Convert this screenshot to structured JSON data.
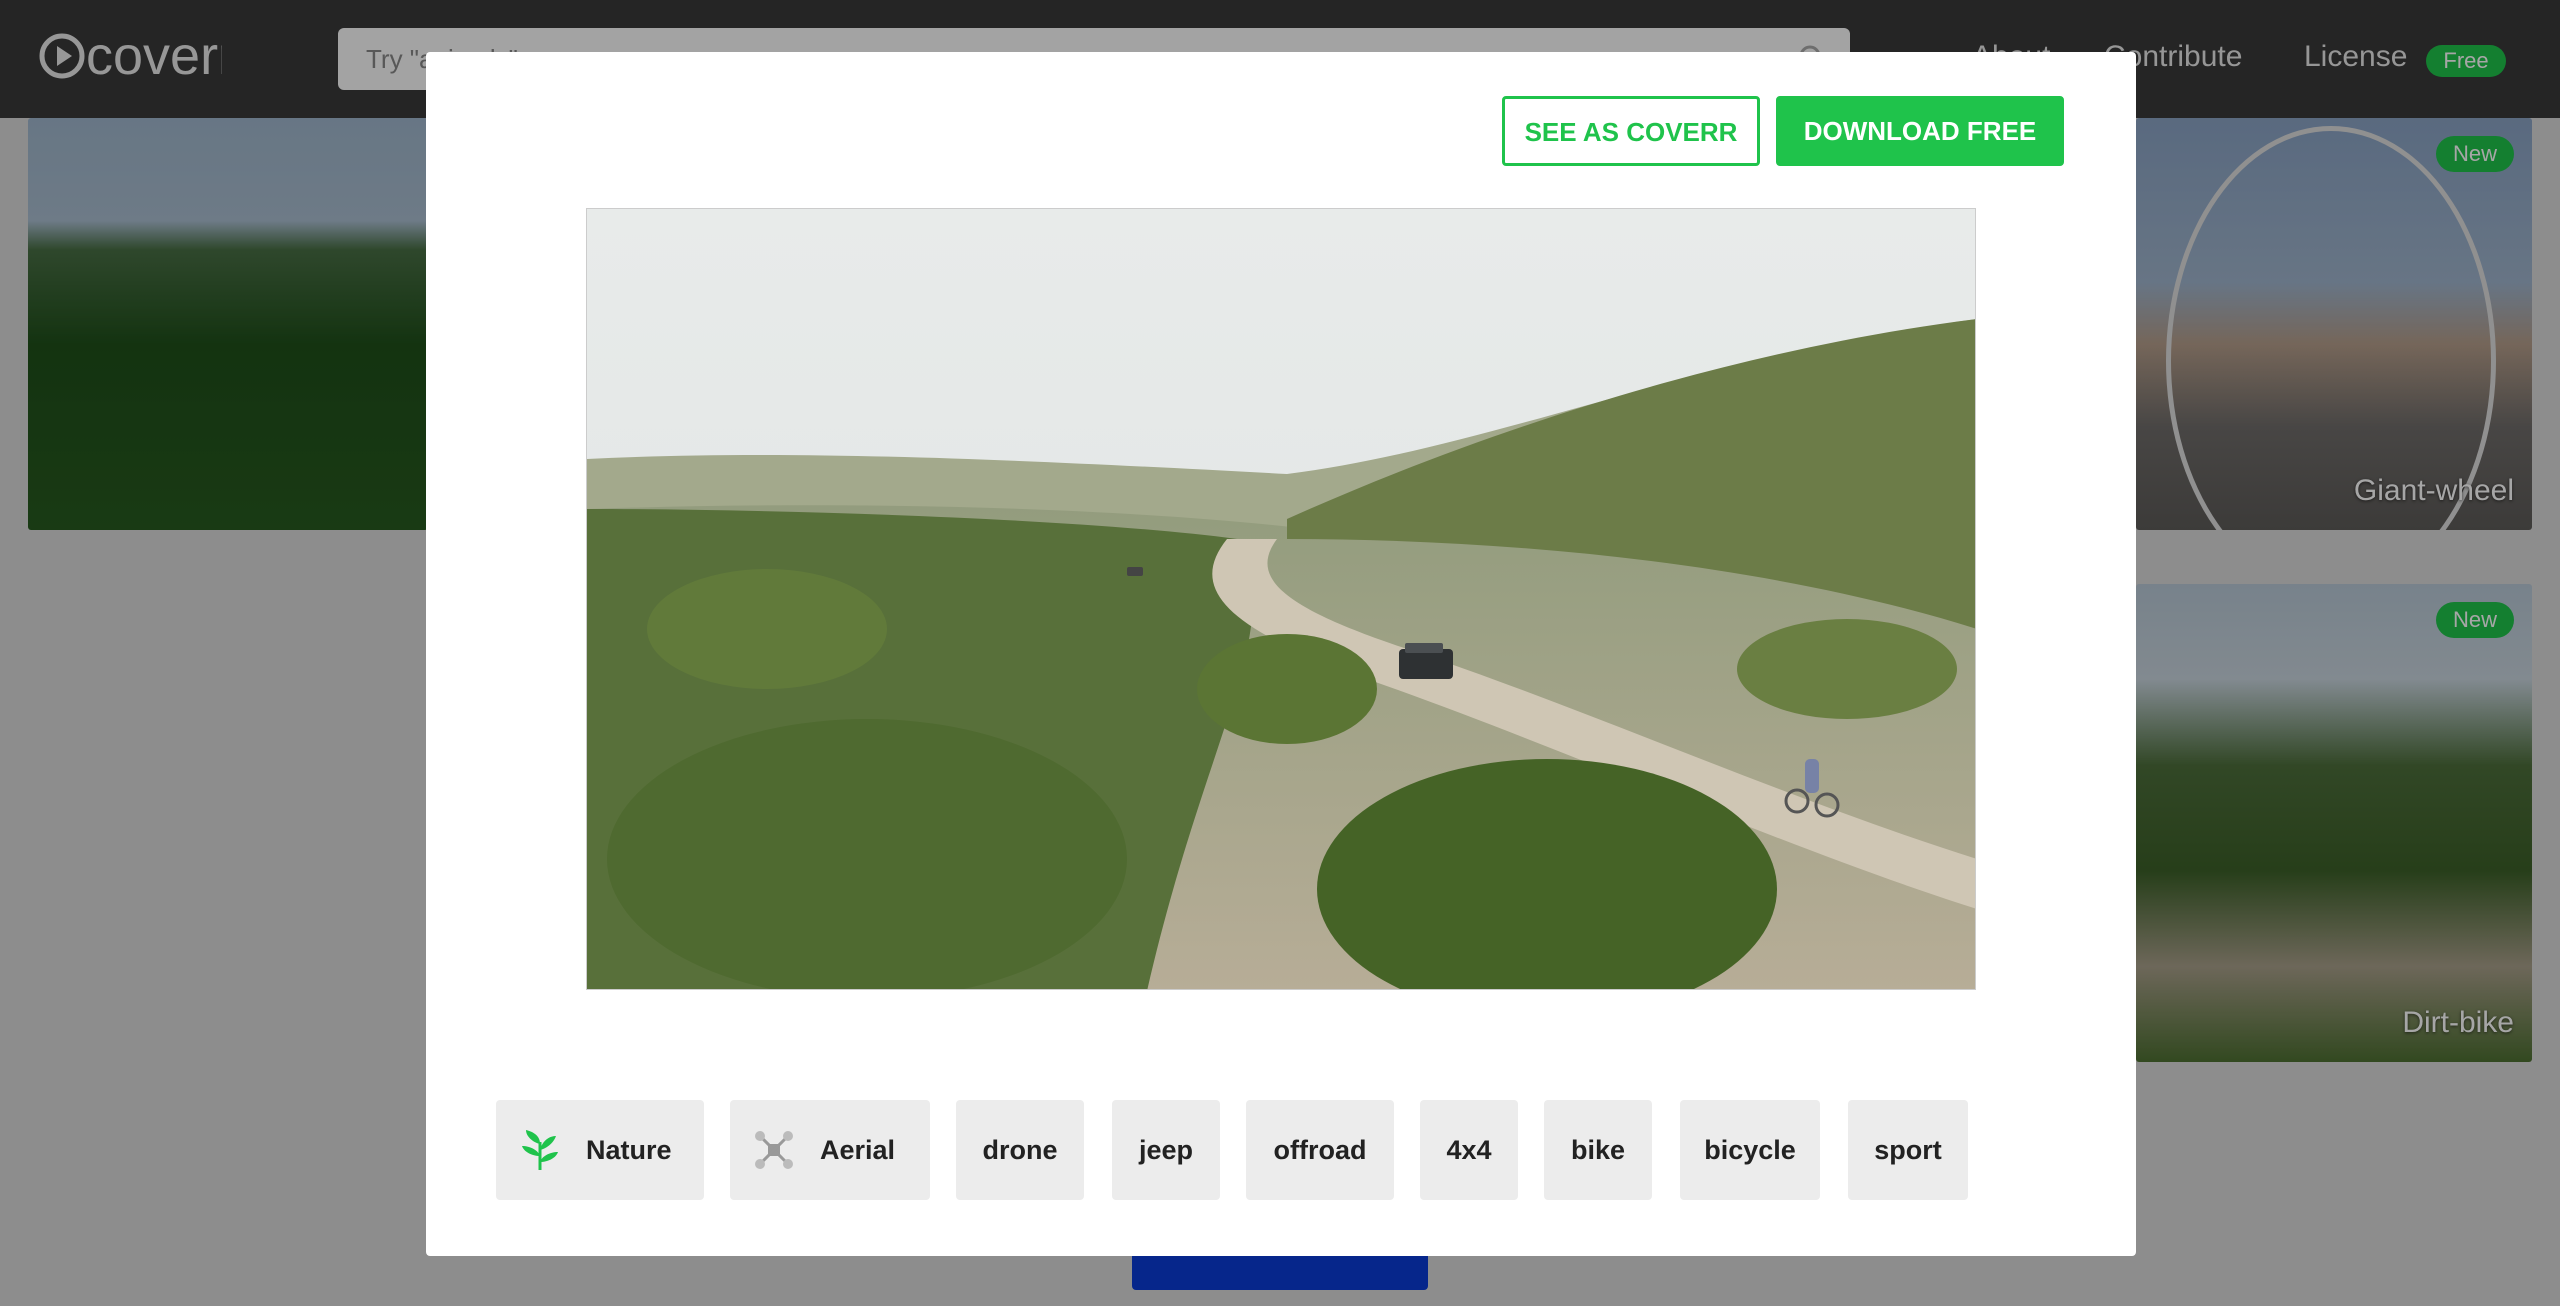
{
  "header": {
    "logo_text": "coverr",
    "search_placeholder": "Try \"animals\"",
    "nav": {
      "about": "About",
      "contribute": "Contribute",
      "license": "License",
      "license_badge": "Free"
    }
  },
  "background_cards": [
    {
      "title": "",
      "badge": ""
    },
    {
      "title": "Giant-wheel",
      "badge": "New"
    },
    {
      "title": "Dirt-bike",
      "badge": "New"
    }
  ],
  "modal": {
    "see_as_coverr_label": "SEE AS COVERR",
    "download_label": "DOWNLOAD FREE",
    "tags": [
      {
        "label": "Nature",
        "icon": "leaf-icon"
      },
      {
        "label": "Aerial",
        "icon": "drone-icon"
      },
      {
        "label": "drone"
      },
      {
        "label": "jeep"
      },
      {
        "label": "offroad"
      },
      {
        "label": "4x4"
      },
      {
        "label": "bike"
      },
      {
        "label": "bicycle"
      },
      {
        "label": "sport"
      }
    ]
  },
  "colors": {
    "accent_green": "#1fc34b",
    "header_bg": "#3a3a3a",
    "load_more_blue": "#0a3bd6"
  }
}
